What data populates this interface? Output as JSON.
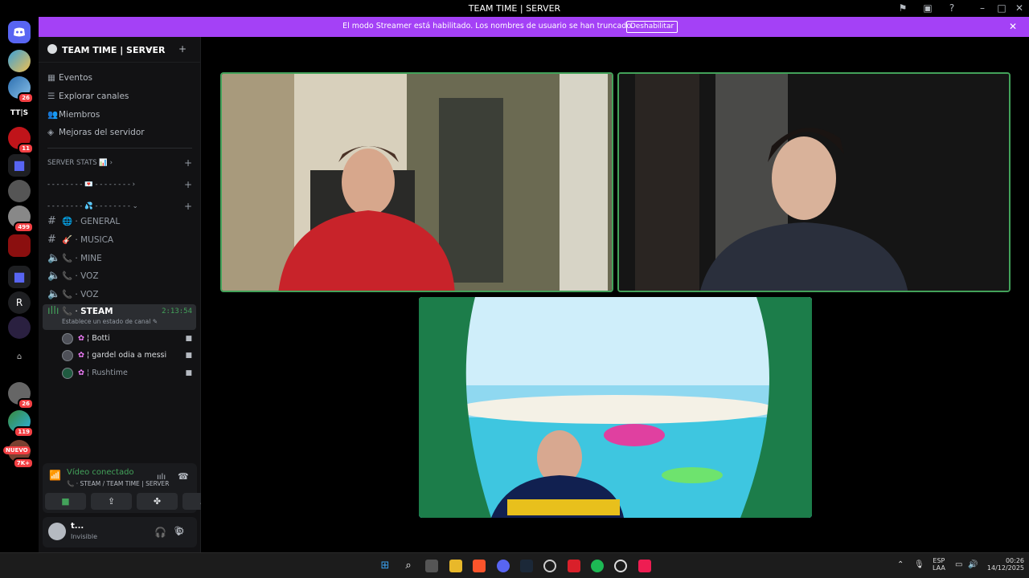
{
  "window": {
    "title": "TEAM TIME | SERVER"
  },
  "banner": {
    "text": "El modo Streamer está habilitado. Los nombres de usuario se han truncado.",
    "button": "Deshabilitar",
    "color": "#a441f6"
  },
  "servers": {
    "badges": [
      "26",
      "11",
      "499",
      "26",
      "119",
      "7K+"
    ],
    "text_icons": [
      "TT|S",
      "R"
    ],
    "new_label": "NUEVO"
  },
  "sidebar": {
    "server_name": "TEAM TIME | SERVER",
    "menu": [
      "Eventos",
      "Explorar canales",
      "Miembros",
      "Mejoras del servidor"
    ],
    "categories": [
      "SERVER STATS 📊",
      "- - - - - - - - 💌 - - - - - - - -",
      "- - - - - - - - 💦 - - - - - - - -"
    ],
    "channels": [
      {
        "name": "GENERAL",
        "icon": "🌐"
      },
      {
        "name": "MUSICA",
        "icon": "🎸"
      },
      {
        "name": "MINE",
        "icon": "📞"
      },
      {
        "name": "VOZ",
        "icon": "📞"
      },
      {
        "name": "VOZ",
        "icon": "📞"
      }
    ],
    "active_channel": {
      "name": "STEAM",
      "timer": "2:13:54",
      "status": "Establece un estado de canal"
    },
    "voice_users": [
      "Botti",
      "gardel odia a messi",
      "Rushtime"
    ]
  },
  "voice": {
    "status": "Vídeo conectado",
    "location": "STEAM / TEAM TIME | SERVER"
  },
  "user": {
    "name": "t...",
    "status": "Invisible"
  },
  "taskbar": {
    "lang": "ESP",
    "lang2": "LAA",
    "time": "00:26",
    "date": "14/12/2025"
  },
  "colors": {
    "accent_green": "#43a25a",
    "streamer_purple": "#a441f6",
    "mention_red": "#f23f43"
  }
}
